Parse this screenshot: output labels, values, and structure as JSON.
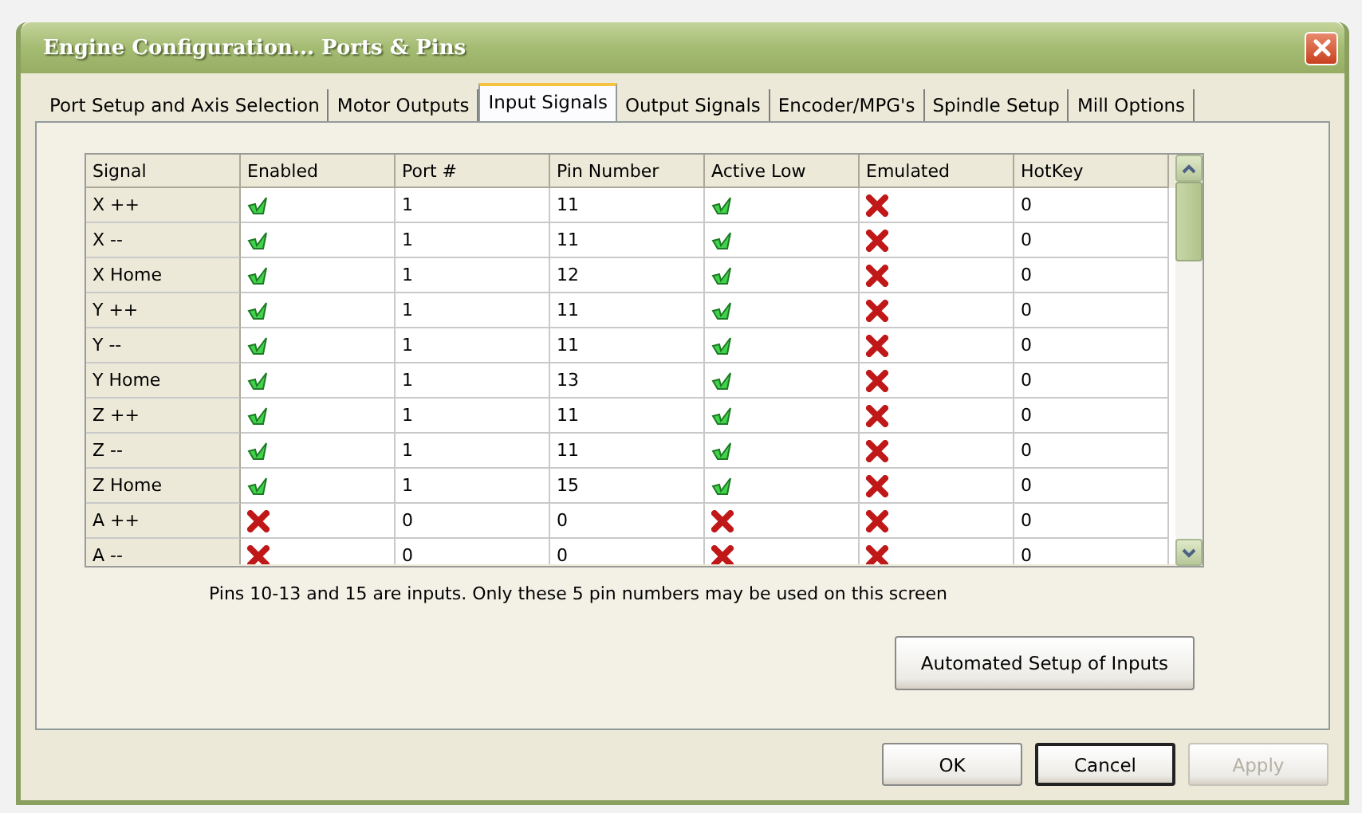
{
  "window": {
    "title": "Engine Configuration... Ports & Pins"
  },
  "tabs": [
    {
      "label": "Port Setup and Axis Selection",
      "selected": false
    },
    {
      "label": "Motor Outputs",
      "selected": false
    },
    {
      "label": "Input Signals",
      "selected": true
    },
    {
      "label": "Output Signals",
      "selected": false
    },
    {
      "label": "Encoder/MPG's",
      "selected": false
    },
    {
      "label": "Spindle Setup",
      "selected": false
    },
    {
      "label": "Mill Options",
      "selected": false
    }
  ],
  "table": {
    "columns": [
      "Signal",
      "Enabled",
      "Port #",
      "Pin Number",
      "Active Low",
      "Emulated",
      "HotKey"
    ],
    "rows": [
      {
        "signal": "X ++",
        "enabled": true,
        "port": "1",
        "pin": "11",
        "active_low": true,
        "emulated": false,
        "hotkey": "0"
      },
      {
        "signal": "X --",
        "enabled": true,
        "port": "1",
        "pin": "11",
        "active_low": true,
        "emulated": false,
        "hotkey": "0"
      },
      {
        "signal": "X Home",
        "enabled": true,
        "port": "1",
        "pin": "12",
        "active_low": true,
        "emulated": false,
        "hotkey": "0"
      },
      {
        "signal": "Y ++",
        "enabled": true,
        "port": "1",
        "pin": "11",
        "active_low": true,
        "emulated": false,
        "hotkey": "0"
      },
      {
        "signal": "Y --",
        "enabled": true,
        "port": "1",
        "pin": "11",
        "active_low": true,
        "emulated": false,
        "hotkey": "0"
      },
      {
        "signal": "Y Home",
        "enabled": true,
        "port": "1",
        "pin": "13",
        "active_low": true,
        "emulated": false,
        "hotkey": "0"
      },
      {
        "signal": "Z ++",
        "enabled": true,
        "port": "1",
        "pin": "11",
        "active_low": true,
        "emulated": false,
        "hotkey": "0"
      },
      {
        "signal": "Z --",
        "enabled": true,
        "port": "1",
        "pin": "11",
        "active_low": true,
        "emulated": false,
        "hotkey": "0"
      },
      {
        "signal": "Z Home",
        "enabled": true,
        "port": "1",
        "pin": "15",
        "active_low": true,
        "emulated": false,
        "hotkey": "0"
      },
      {
        "signal": "A ++",
        "enabled": false,
        "port": "0",
        "pin": "0",
        "active_low": false,
        "emulated": false,
        "hotkey": "0"
      },
      {
        "signal": "A --",
        "enabled": false,
        "port": "0",
        "pin": "0",
        "active_low": false,
        "emulated": false,
        "hotkey": "0"
      }
    ]
  },
  "note": "Pins 10-13 and 15 are inputs. Only these 5 pin numbers may be used on this screen",
  "automated_button": "Automated Setup of Inputs",
  "buttons": [
    {
      "label": "OK",
      "disabled": false,
      "default": false
    },
    {
      "label": "Cancel",
      "disabled": false,
      "default": true
    },
    {
      "label": "Apply",
      "disabled": true,
      "default": false
    }
  ]
}
